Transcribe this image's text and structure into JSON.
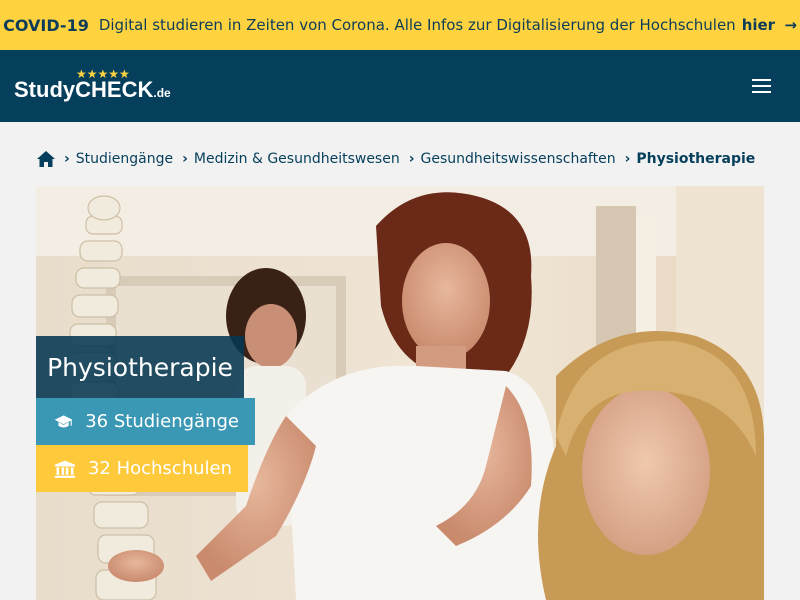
{
  "covid_banner": {
    "tag": "COVID-19",
    "text": "Digital studieren in Zeiten von Corona. Alle Infos zur Digitalisierung der Hochschulen",
    "link_label": "hier",
    "arrow": "→"
  },
  "header": {
    "logo_stars": "★★★★★",
    "logo_study": "Study",
    "logo_check": "CHECK",
    "logo_tld": ".de",
    "menu_icon": "hamburger-menu-icon"
  },
  "breadcrumb": {
    "home_icon": "home-icon",
    "separator": "›",
    "items": [
      "Studiengänge",
      "Medizin & Gesundheitswesen",
      "Gesundheitswissenschaften"
    ],
    "current": "Physiotherapie"
  },
  "hero": {
    "title": "Physiotherapie",
    "studiengaenge": "36 Studiengänge",
    "hochschulen": "32 Hochschulen",
    "studiengaenge_icon": "graduation-cap-icon",
    "hochschulen_icon": "university-building-icon"
  },
  "colors": {
    "banner": "#ffd33f",
    "header": "#053f5c",
    "title_box": "#053752",
    "badge_blue": "#3b98b4",
    "badge_yellow": "#fec93b"
  }
}
